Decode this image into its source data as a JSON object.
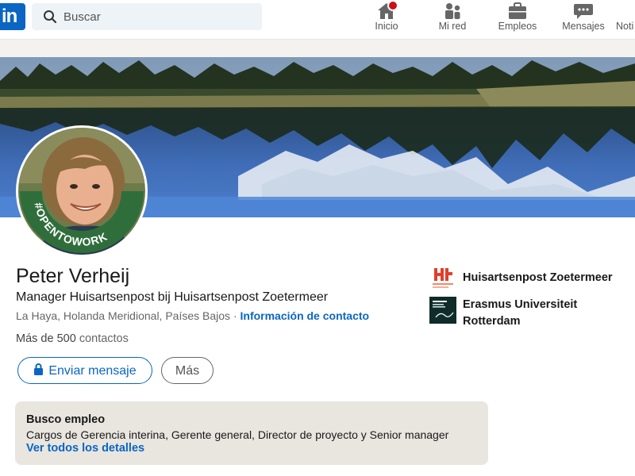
{
  "nav": {
    "logo_text": "in",
    "search_placeholder": "Buscar",
    "items": [
      {
        "label": "Inicio",
        "icon": "home-icon",
        "has_badge": true
      },
      {
        "label": "Mi red",
        "icon": "network-icon"
      },
      {
        "label": "Empleos",
        "icon": "briefcase-icon"
      },
      {
        "label": "Mensajes",
        "icon": "messaging-icon"
      },
      {
        "label": "Noti",
        "icon": "bell-icon"
      }
    ]
  },
  "profile": {
    "avatar_frame_text": "#OPENTOWORK",
    "name": "Peter Verheij",
    "headline": "Manager Huisartsenpost bij Huisartsenpost Zoetermeer",
    "location": "La Haya, Holanda Meridional, Países Bajos",
    "separator": "·",
    "contact_link": "Información de contacto",
    "connections_prefix": "Más de 500",
    "connections_suffix": "contactos",
    "message_button": "Enviar mensaje",
    "more_button": "Más"
  },
  "organizations": [
    {
      "name_line1": "Huisartsenpost Zoetermeer",
      "name_line2": "",
      "icon": "huisartsenpost-logo-icon"
    },
    {
      "name_line1": "Erasmus Universiteit",
      "name_line2": "Rotterdam",
      "icon": "erasmus-logo-icon"
    }
  ],
  "open_to_work": {
    "title": "Busco empleo",
    "roles": "Cargos de Gerencia interina, Gerente general, Director de proyecto y Senior manager",
    "details_link": "Ver todos los detalles"
  },
  "colors": {
    "brand": "#0a66c2",
    "open_to_work_green": "#2f6e3b",
    "badge_red": "#cc1016"
  }
}
